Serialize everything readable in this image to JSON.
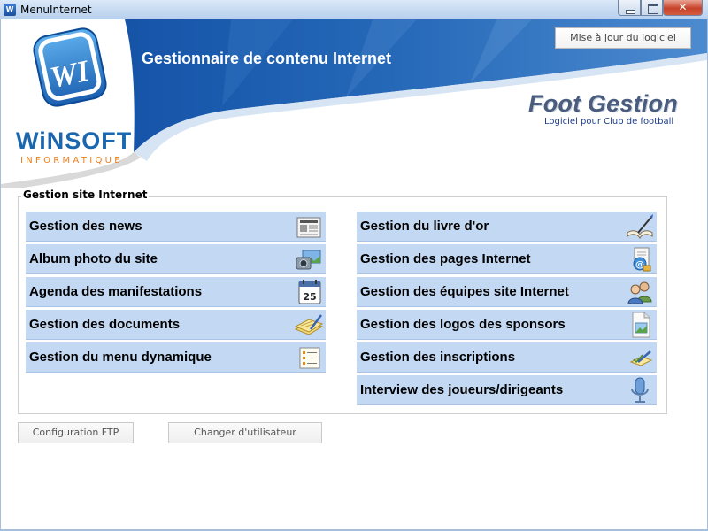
{
  "window": {
    "title": "MenuInternet",
    "icon_label": "W",
    "close_glyph": "✕"
  },
  "header": {
    "title": "Gestionnaire de contenu Internet",
    "update_button": "Mise à jour du logiciel",
    "product_name": "Foot Gestion",
    "product_subtitle": "Logiciel pour Club de football",
    "logo_name": "WiNSOFT",
    "logo_sub": "INFORMATIQUE",
    "logo_monogram": "WI"
  },
  "group": {
    "title": "Gestion site Internet",
    "left_items": [
      {
        "label": "Gestion des news",
        "icon": "newspaper-icon"
      },
      {
        "label": "Album photo du site",
        "icon": "photo-album-icon"
      },
      {
        "label": "Agenda des manifestations",
        "icon": "calendar-icon"
      },
      {
        "label": "Gestion des documents",
        "icon": "documents-icon"
      },
      {
        "label": "Gestion du menu dynamique",
        "icon": "menu-list-icon"
      }
    ],
    "right_items": [
      {
        "label": "Gestion du livre d'or",
        "icon": "guestbook-icon"
      },
      {
        "label": "Gestion des pages Internet",
        "icon": "web-page-icon"
      },
      {
        "label": "Gestion des équipes site Internet",
        "icon": "teams-icon"
      },
      {
        "label": "Gestion des logos des sponsors",
        "icon": "image-file-icon"
      },
      {
        "label": "Gestion des inscriptions",
        "icon": "signup-pencil-icon"
      },
      {
        "label": "Interview des joueurs/dirigeants",
        "icon": "microphone-icon"
      }
    ],
    "calendar_day": "25"
  },
  "footer": {
    "ftp_button": "Configuration FTP",
    "user_button": "Changer d'utilisateur"
  },
  "colors": {
    "menu_item_bg": "#c2d8f3",
    "banner_blue": "#1f5cab",
    "logo_orange": "#ee7e1a"
  }
}
